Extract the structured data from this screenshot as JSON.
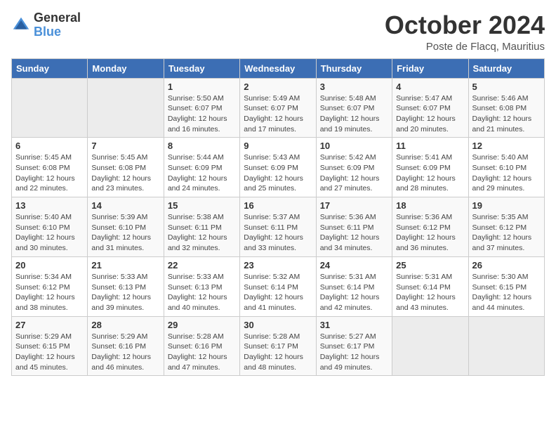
{
  "header": {
    "logo_general": "General",
    "logo_blue": "Blue",
    "month_title": "October 2024",
    "location": "Poste de Flacq, Mauritius"
  },
  "days_of_week": [
    "Sunday",
    "Monday",
    "Tuesday",
    "Wednesday",
    "Thursday",
    "Friday",
    "Saturday"
  ],
  "weeks": [
    [
      {
        "day": "",
        "sunrise": "",
        "sunset": "",
        "daylight": ""
      },
      {
        "day": "",
        "sunrise": "",
        "sunset": "",
        "daylight": ""
      },
      {
        "day": "1",
        "sunrise": "Sunrise: 5:50 AM",
        "sunset": "Sunset: 6:07 PM",
        "daylight": "Daylight: 12 hours and 16 minutes."
      },
      {
        "day": "2",
        "sunrise": "Sunrise: 5:49 AM",
        "sunset": "Sunset: 6:07 PM",
        "daylight": "Daylight: 12 hours and 17 minutes."
      },
      {
        "day": "3",
        "sunrise": "Sunrise: 5:48 AM",
        "sunset": "Sunset: 6:07 PM",
        "daylight": "Daylight: 12 hours and 19 minutes."
      },
      {
        "day": "4",
        "sunrise": "Sunrise: 5:47 AM",
        "sunset": "Sunset: 6:07 PM",
        "daylight": "Daylight: 12 hours and 20 minutes."
      },
      {
        "day": "5",
        "sunrise": "Sunrise: 5:46 AM",
        "sunset": "Sunset: 6:08 PM",
        "daylight": "Daylight: 12 hours and 21 minutes."
      }
    ],
    [
      {
        "day": "6",
        "sunrise": "Sunrise: 5:45 AM",
        "sunset": "Sunset: 6:08 PM",
        "daylight": "Daylight: 12 hours and 22 minutes."
      },
      {
        "day": "7",
        "sunrise": "Sunrise: 5:45 AM",
        "sunset": "Sunset: 6:08 PM",
        "daylight": "Daylight: 12 hours and 23 minutes."
      },
      {
        "day": "8",
        "sunrise": "Sunrise: 5:44 AM",
        "sunset": "Sunset: 6:09 PM",
        "daylight": "Daylight: 12 hours and 24 minutes."
      },
      {
        "day": "9",
        "sunrise": "Sunrise: 5:43 AM",
        "sunset": "Sunset: 6:09 PM",
        "daylight": "Daylight: 12 hours and 25 minutes."
      },
      {
        "day": "10",
        "sunrise": "Sunrise: 5:42 AM",
        "sunset": "Sunset: 6:09 PM",
        "daylight": "Daylight: 12 hours and 27 minutes."
      },
      {
        "day": "11",
        "sunrise": "Sunrise: 5:41 AM",
        "sunset": "Sunset: 6:09 PM",
        "daylight": "Daylight: 12 hours and 28 minutes."
      },
      {
        "day": "12",
        "sunrise": "Sunrise: 5:40 AM",
        "sunset": "Sunset: 6:10 PM",
        "daylight": "Daylight: 12 hours and 29 minutes."
      }
    ],
    [
      {
        "day": "13",
        "sunrise": "Sunrise: 5:40 AM",
        "sunset": "Sunset: 6:10 PM",
        "daylight": "Daylight: 12 hours and 30 minutes."
      },
      {
        "day": "14",
        "sunrise": "Sunrise: 5:39 AM",
        "sunset": "Sunset: 6:10 PM",
        "daylight": "Daylight: 12 hours and 31 minutes."
      },
      {
        "day": "15",
        "sunrise": "Sunrise: 5:38 AM",
        "sunset": "Sunset: 6:11 PM",
        "daylight": "Daylight: 12 hours and 32 minutes."
      },
      {
        "day": "16",
        "sunrise": "Sunrise: 5:37 AM",
        "sunset": "Sunset: 6:11 PM",
        "daylight": "Daylight: 12 hours and 33 minutes."
      },
      {
        "day": "17",
        "sunrise": "Sunrise: 5:36 AM",
        "sunset": "Sunset: 6:11 PM",
        "daylight": "Daylight: 12 hours and 34 minutes."
      },
      {
        "day": "18",
        "sunrise": "Sunrise: 5:36 AM",
        "sunset": "Sunset: 6:12 PM",
        "daylight": "Daylight: 12 hours and 36 minutes."
      },
      {
        "day": "19",
        "sunrise": "Sunrise: 5:35 AM",
        "sunset": "Sunset: 6:12 PM",
        "daylight": "Daylight: 12 hours and 37 minutes."
      }
    ],
    [
      {
        "day": "20",
        "sunrise": "Sunrise: 5:34 AM",
        "sunset": "Sunset: 6:12 PM",
        "daylight": "Daylight: 12 hours and 38 minutes."
      },
      {
        "day": "21",
        "sunrise": "Sunrise: 5:33 AM",
        "sunset": "Sunset: 6:13 PM",
        "daylight": "Daylight: 12 hours and 39 minutes."
      },
      {
        "day": "22",
        "sunrise": "Sunrise: 5:33 AM",
        "sunset": "Sunset: 6:13 PM",
        "daylight": "Daylight: 12 hours and 40 minutes."
      },
      {
        "day": "23",
        "sunrise": "Sunrise: 5:32 AM",
        "sunset": "Sunset: 6:14 PM",
        "daylight": "Daylight: 12 hours and 41 minutes."
      },
      {
        "day": "24",
        "sunrise": "Sunrise: 5:31 AM",
        "sunset": "Sunset: 6:14 PM",
        "daylight": "Daylight: 12 hours and 42 minutes."
      },
      {
        "day": "25",
        "sunrise": "Sunrise: 5:31 AM",
        "sunset": "Sunset: 6:14 PM",
        "daylight": "Daylight: 12 hours and 43 minutes."
      },
      {
        "day": "26",
        "sunrise": "Sunrise: 5:30 AM",
        "sunset": "Sunset: 6:15 PM",
        "daylight": "Daylight: 12 hours and 44 minutes."
      }
    ],
    [
      {
        "day": "27",
        "sunrise": "Sunrise: 5:29 AM",
        "sunset": "Sunset: 6:15 PM",
        "daylight": "Daylight: 12 hours and 45 minutes."
      },
      {
        "day": "28",
        "sunrise": "Sunrise: 5:29 AM",
        "sunset": "Sunset: 6:16 PM",
        "daylight": "Daylight: 12 hours and 46 minutes."
      },
      {
        "day": "29",
        "sunrise": "Sunrise: 5:28 AM",
        "sunset": "Sunset: 6:16 PM",
        "daylight": "Daylight: 12 hours and 47 minutes."
      },
      {
        "day": "30",
        "sunrise": "Sunrise: 5:28 AM",
        "sunset": "Sunset: 6:17 PM",
        "daylight": "Daylight: 12 hours and 48 minutes."
      },
      {
        "day": "31",
        "sunrise": "Sunrise: 5:27 AM",
        "sunset": "Sunset: 6:17 PM",
        "daylight": "Daylight: 12 hours and 49 minutes."
      },
      {
        "day": "",
        "sunrise": "",
        "sunset": "",
        "daylight": ""
      },
      {
        "day": "",
        "sunrise": "",
        "sunset": "",
        "daylight": ""
      }
    ]
  ]
}
